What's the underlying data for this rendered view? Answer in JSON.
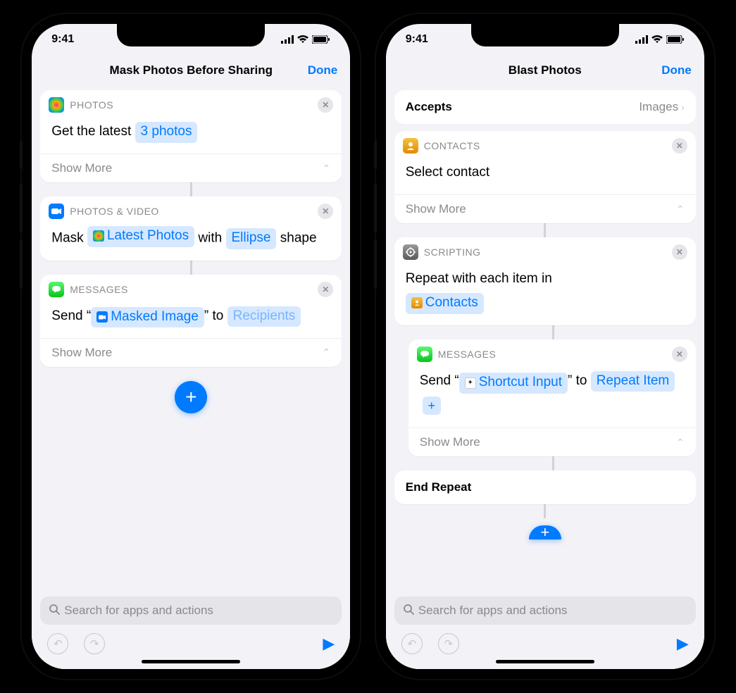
{
  "status": {
    "time": "9:41"
  },
  "left": {
    "title": "Mask Photos Before Sharing",
    "done": "Done",
    "card1": {
      "category": "PHOTOS",
      "line_a": "Get the latest",
      "token": "3 photos",
      "showmore": "Show More"
    },
    "card2": {
      "category": "PHOTOS & VIDEO",
      "t1": "Mask",
      "token1": "Latest Photos",
      "t2": "with",
      "token2": "Ellipse",
      "t3": "shape"
    },
    "card3": {
      "category": "MESSAGES",
      "t1": "Send “",
      "token1": "Masked Image",
      "t2": "” to",
      "token2": "Recipients",
      "showmore": "Show More"
    },
    "search_placeholder": "Search for apps and actions"
  },
  "right": {
    "title": "Blast Photos",
    "done": "Done",
    "accepts_label": "Accepts",
    "accepts_value": "Images",
    "card1": {
      "category": "CONTACTS",
      "body": "Select contact",
      "showmore": "Show More"
    },
    "card2": {
      "category": "SCRIPTING",
      "t1": "Repeat with each item in",
      "token1": "Contacts"
    },
    "card3": {
      "category": "MESSAGES",
      "t1": "Send “",
      "token1": "Shortcut Input",
      "t2": "” to",
      "token2": "Repeat Item",
      "showmore": "Show More"
    },
    "endrepeat": "End Repeat",
    "search_placeholder": "Search for apps and actions"
  }
}
